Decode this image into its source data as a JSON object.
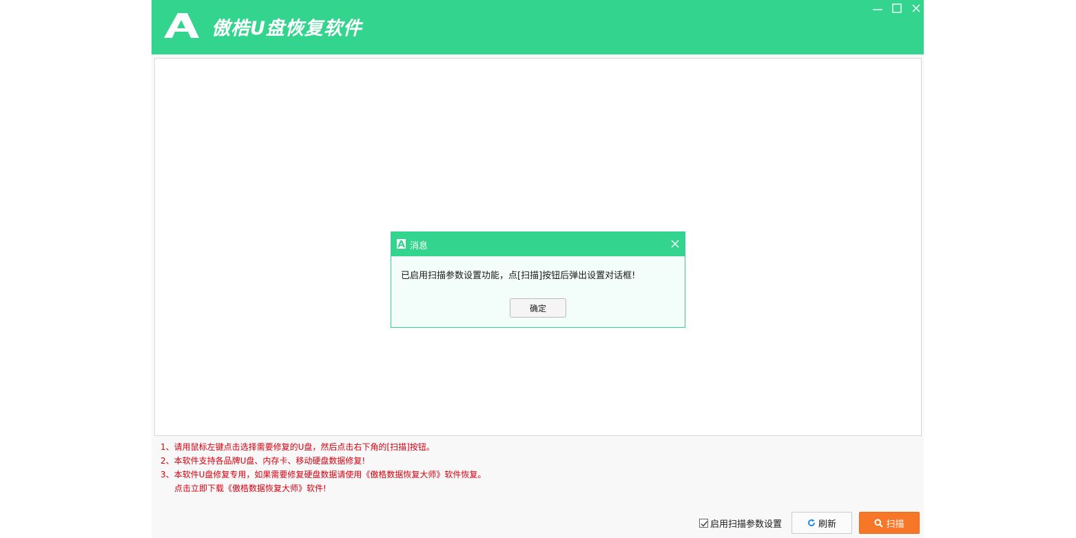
{
  "window": {
    "title": "傲梏U盘恢复软件",
    "accent_color": "#33d48e",
    "icons": [
      "minimize-icon",
      "maximize-icon",
      "close-icon"
    ]
  },
  "tips": [
    "1、请用鼠标左键点击选择需要修复的U盘，然后点击右下角的[扫描]按钮。",
    "2、本软件支持各品牌U盘、内存卡、移动硬盘数据修复!",
    "3、本软件U盘修复专用，如果需要修复硬盘数据请使用《傲梏数据恢复大师》软件恢复。",
    "点击立即下载《傲梏数据恢复大师》软件!"
  ],
  "tips_color": "#d6000f",
  "options": {
    "scan_params_label": "启用扫描参数设置",
    "scan_params_checked": true
  },
  "buttons": {
    "refresh_label": "刷新",
    "scan_label": "扫描",
    "scan_color": "#f67728"
  },
  "dialog": {
    "title": "消息",
    "message": "已启用扫描参数设置功能，点[扫描]按钮后弹出设置对话框!",
    "ok_label": "确定"
  }
}
